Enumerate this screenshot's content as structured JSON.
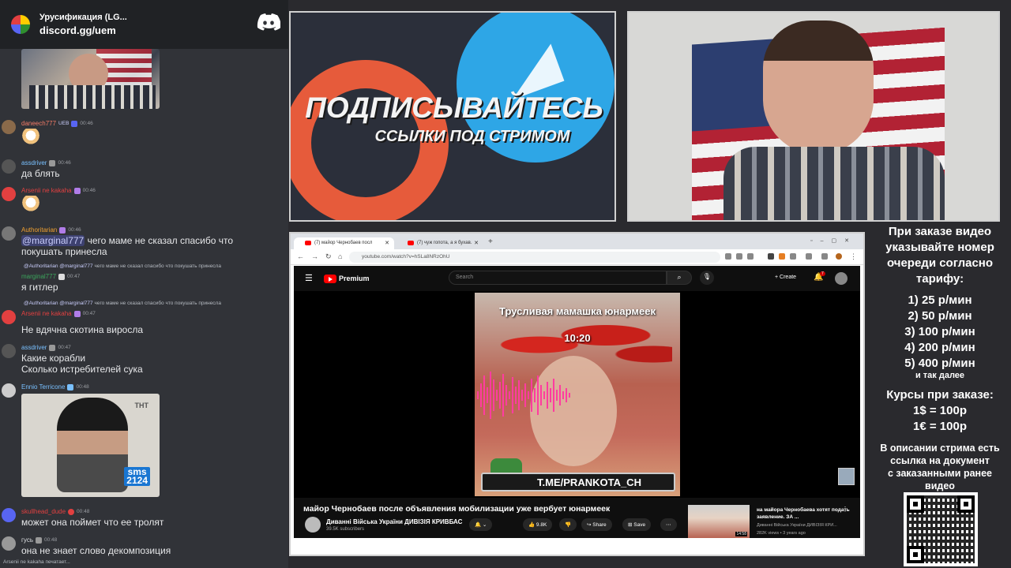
{
  "discord": {
    "server_name": "Урусификация (LG...",
    "invite": "discord.gg/uem"
  },
  "chat": [
    {
      "user": "daneech777",
      "tag": "UEB",
      "time": "00:46",
      "text": "",
      "color": "#f47b67"
    },
    {
      "user": "assdriver",
      "time": "00:46",
      "text": "да блять",
      "color": "#79c0ff"
    },
    {
      "user": "Arsenii ne kakaha",
      "time": "00:46",
      "text": "",
      "color": "#e24040"
    },
    {
      "user": "Authoritarian",
      "time": "00:46",
      "mention": "@marginal777",
      "text": " чего маме не сказал спасибо что",
      "text2": "покушать принесла",
      "color": "#f0a030"
    },
    {
      "reply_user": "@Authoritarian",
      "reply_mention": "@marginal777",
      "reply_text": "чего маме не сказал спасибо что покушать принесла",
      "user": "marginal777",
      "time": "00:47",
      "text": "я гитлер",
      "color": "#3ba55c"
    },
    {
      "reply_user": "@Authoritarian",
      "reply_mention": "@marginal777",
      "reply_text": "чего маме не сказал спасибо что покушать принесла",
      "user": "Arsenii ne kakaha",
      "time": "00:47",
      "text": "Не вдячна скотина виросла",
      "color": "#e24040"
    },
    {
      "user": "assdriver",
      "time": "00:47",
      "text": "Какие корабли",
      "text2": "Сколько истребителей сука",
      "color": "#79c0ff"
    },
    {
      "user": "Ennio Terricone",
      "time": "00:48",
      "text": "",
      "color": "#79c0ff"
    },
    {
      "user": "skullhead_dude",
      "time": "00:48",
      "text": "может она поймет что ее тролят",
      "color": "#e24040"
    },
    {
      "user": "гусь",
      "time": "00:48",
      "text": "она не знает слово декомпозиция",
      "color": "#dbdee1"
    }
  ],
  "typing": "Arsenii ne kakaha печатает...",
  "sms_badge": "sms\n2124",
  "promo": {
    "title": "ПОДПИСЫВАЙТЕСЬ",
    "subtitle": "ССЫЛКИ ПОД СТРИМОМ"
  },
  "browser": {
    "tab1": "(7) майор Чернобаев посл",
    "tab2": "(7) чуж гопота, а я бухав.",
    "url": "youtube.com/watch?v=hSLa8NRzOhU"
  },
  "youtube": {
    "brand": "Premium",
    "search_placeholder": "Search",
    "create_label": "Create",
    "notif_count": "7",
    "video_overlay_title": "Трусливая мамашка юнармеек",
    "video_overlay_time": "10:20",
    "tme_link": "T.ME/PRANKOTA_CH",
    "video_title": "майор Чернобаев после объявления мобилизации уже вербует юнармеек",
    "channel_name": "Диванні Війська України ДИВІЗІЯ КРИВБАС",
    "subscribers": "39.5K subscribers",
    "likes": "9.8K",
    "share_label": "Share",
    "save_label": "Save",
    "rec_title": "на майора Чернобаева хотят подать заявление. ЗА ...",
    "rec_channel": "Диванні Війська України ДИВІЗІЯ КРИ...",
    "rec_meta": "282K views • 3 years ago",
    "rec_duration": "14:58"
  },
  "info": {
    "heading": [
      "При заказе видео",
      "указывайте номер",
      "очереди согласно",
      "тарифу:"
    ],
    "prices": [
      "1) 25 р/мин",
      "2) 50 р/мин",
      "3) 100 р/мин",
      "4) 200 р/мин",
      "5) 400 р/мин"
    ],
    "and_so_on": "и так далее",
    "rates_title": "Курсы при заказе:",
    "rates": [
      "1$ = 100р",
      "1€ = 100р"
    ],
    "doc_note": [
      "В описании стрима есть",
      "ссылка на документ",
      "с заказанными ранее",
      "видео"
    ]
  }
}
